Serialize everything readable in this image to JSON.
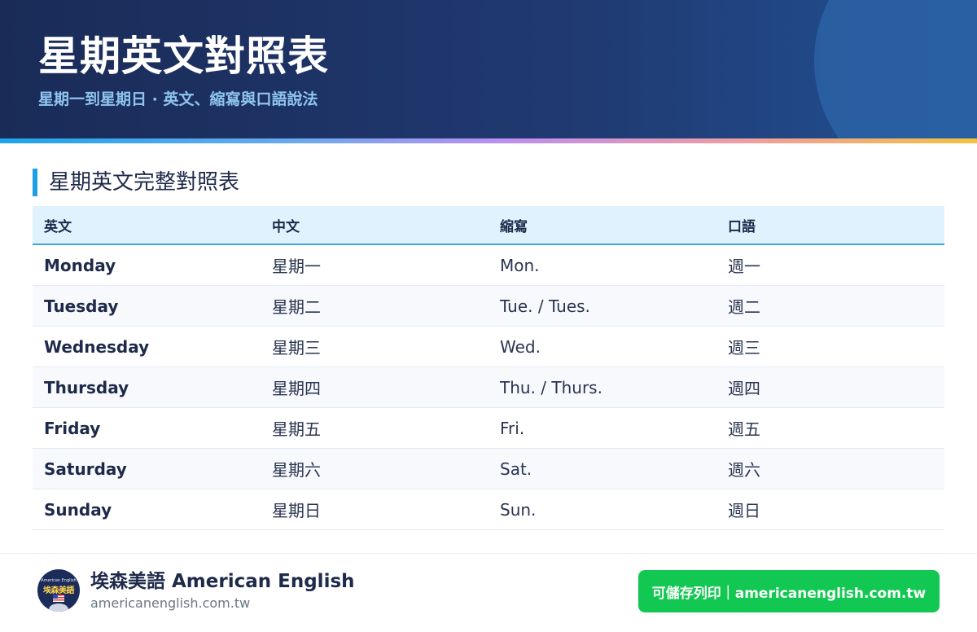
{
  "header": {
    "title": "星期英文對照表",
    "subtitle": "星期一到星期日 · 英文、縮寫與口語說法"
  },
  "section": {
    "title": "星期英文完整對照表"
  },
  "table": {
    "headers": [
      "英文",
      "中文",
      "縮寫",
      "口語"
    ],
    "rows": [
      {
        "en": "Monday",
        "zh": "星期一",
        "abbr": "Mon.",
        "spoken": "週一"
      },
      {
        "en": "Tuesday",
        "zh": "星期二",
        "abbr": "Tue. / Tues.",
        "spoken": "週二"
      },
      {
        "en": "Wednesday",
        "zh": "星期三",
        "abbr": "Wed.",
        "spoken": "週三"
      },
      {
        "en": "Thursday",
        "zh": "星期四",
        "abbr": "Thu. / Thurs.",
        "spoken": "週四"
      },
      {
        "en": "Friday",
        "zh": "星期五",
        "abbr": "Fri.",
        "spoken": "週五"
      },
      {
        "en": "Saturday",
        "zh": "星期六",
        "abbr": "Sat.",
        "spoken": "週六"
      },
      {
        "en": "Sunday",
        "zh": "星期日",
        "abbr": "Sun.",
        "spoken": "週日"
      }
    ]
  },
  "footer": {
    "brand": "埃森美語 American English",
    "site": "americanenglish.com.tw",
    "print_label": "可儲存列印｜americanenglish.com.tw",
    "logo_top": "American English",
    "logo_mid": "埃森美語"
  },
  "colors": {
    "header_bg": "#1a2b57",
    "accent": "#1ea0e6",
    "button": "#13c852"
  },
  "icons": {
    "logo": "brand-logo-icon",
    "flag": "us-flag-icon"
  }
}
